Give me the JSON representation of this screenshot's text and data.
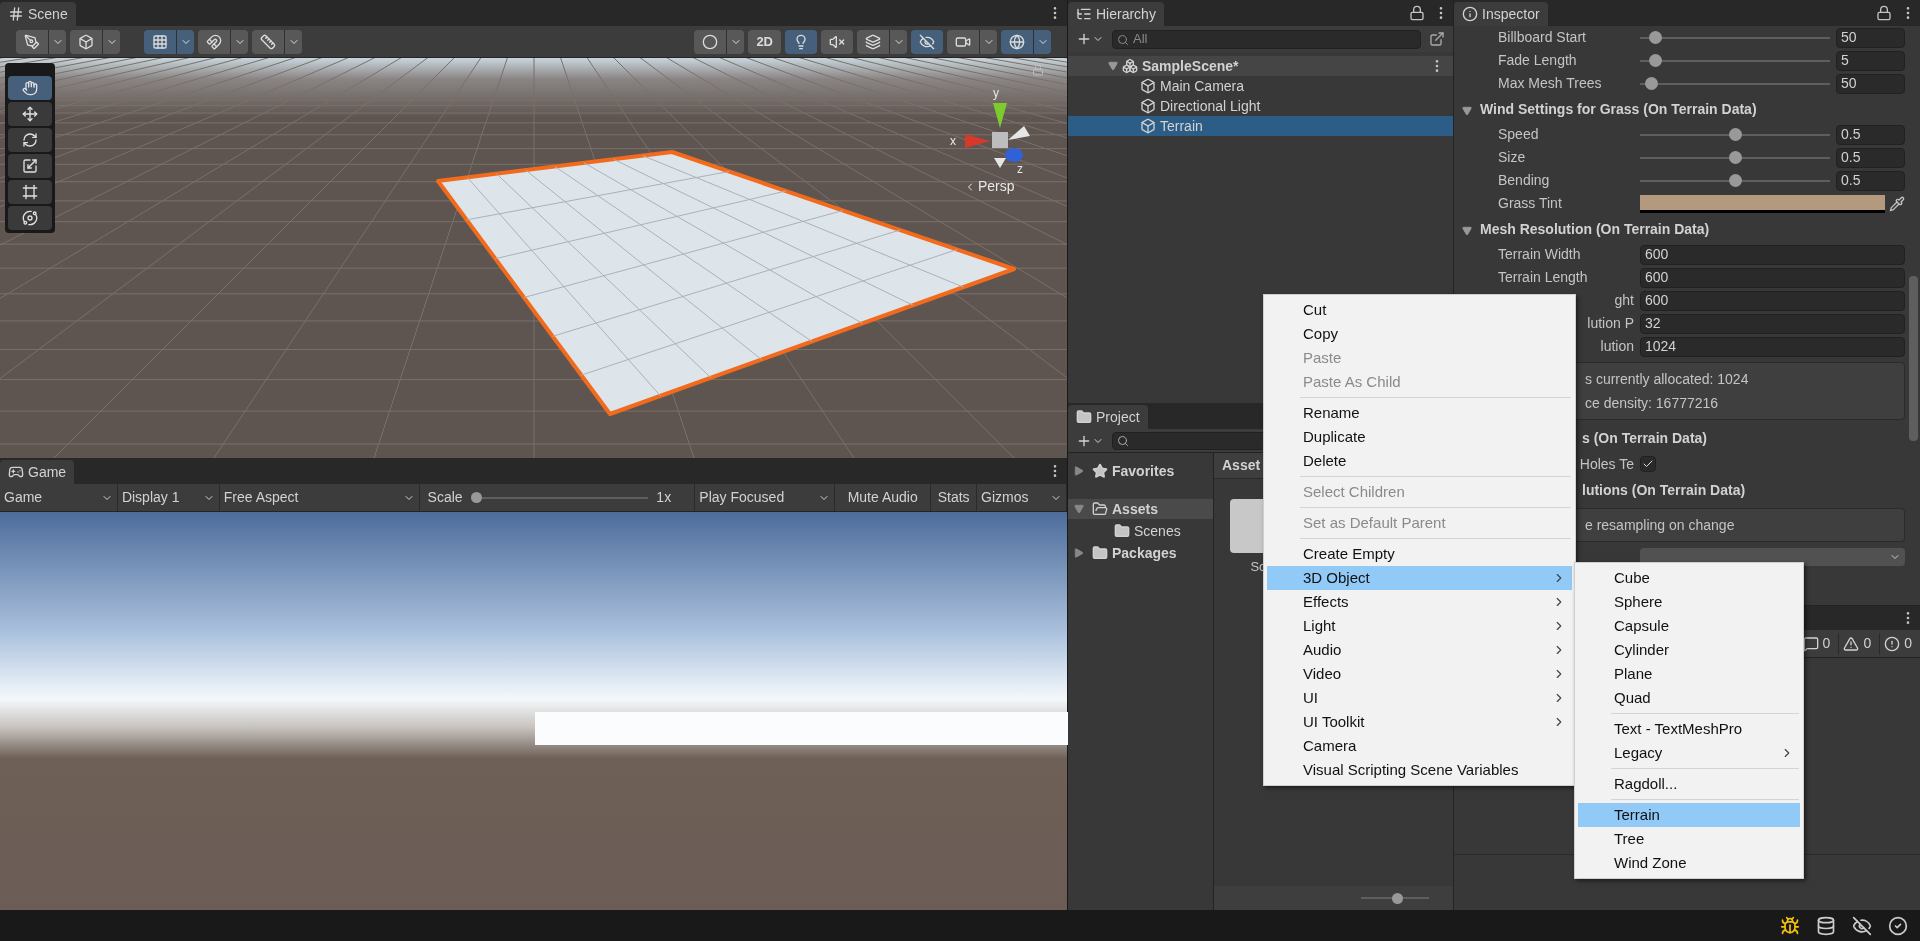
{
  "scene": {
    "tab": "Scene",
    "toolbar_left": [
      {
        "kind": "tool-handle",
        "on": false,
        "dropdown": true
      },
      {
        "kind": "pivot",
        "on": false,
        "dropdown": true
      }
    ],
    "toolbar_grid": [
      {
        "kind": "grid",
        "on": true,
        "dropdown": true
      },
      {
        "kind": "snap",
        "on": false,
        "dropdown": true
      },
      {
        "kind": "increment",
        "on": false,
        "dropdown": true
      }
    ],
    "toolbar_right": [
      {
        "kind": "shading",
        "on": false,
        "dropdown": true
      },
      {
        "kind": "label",
        "label": "2D",
        "on": false,
        "dropdown": false
      },
      {
        "kind": "lighting",
        "on": true,
        "dropdown": false
      },
      {
        "kind": "audio",
        "on": false,
        "dropdown": false
      },
      {
        "kind": "effects",
        "on": false,
        "dropdown": true
      },
      {
        "kind": "visibility",
        "on": true,
        "dropdown": false
      },
      {
        "kind": "camera",
        "on": false,
        "dropdown": true
      },
      {
        "kind": "gizmos",
        "on": true,
        "dropdown": true
      }
    ],
    "tools": [
      {
        "kind": "hand",
        "selected": true
      },
      {
        "kind": "move",
        "selected": false
      },
      {
        "kind": "rotate",
        "selected": false
      },
      {
        "kind": "scale",
        "selected": false
      },
      {
        "kind": "rect",
        "selected": false
      },
      {
        "kind": "transform",
        "selected": false
      }
    ],
    "axis_labels": [
      "x",
      "y",
      "z"
    ],
    "view_label": "Persp"
  },
  "game": {
    "tab": "Game",
    "toolbar": [
      {
        "kind": "dropdown",
        "label": "Game"
      },
      {
        "kind": "dropdown",
        "label": "Display 1"
      },
      {
        "kind": "dropdown",
        "label": "Free Aspect"
      },
      {
        "kind": "slider",
        "label": "Scale",
        "level": 0.0,
        "reading": "1x"
      },
      {
        "kind": "dropdown",
        "label": "Play Focused"
      },
      {
        "kind": "toggle",
        "label": "Mute Audio",
        "on": false
      },
      {
        "kind": "toggle",
        "label": "Stats",
        "on": false
      },
      {
        "kind": "dropdown",
        "label": "Gizmos"
      }
    ]
  },
  "hierarchy": {
    "tab": "Hierarchy",
    "search": {
      "placeholder": "All"
    },
    "tree": [
      {
        "label": "SampleScene*",
        "kind": "scene",
        "expanded": true,
        "selected": false,
        "children": [
          {
            "label": "Main Camera",
            "kind": "object",
            "selected": false
          },
          {
            "label": "Directional Light",
            "kind": "object",
            "selected": false
          },
          {
            "label": "Terrain",
            "kind": "object",
            "selected": true
          }
        ]
      }
    ]
  },
  "project": {
    "tab": "Project",
    "tree": [
      {
        "label": "Favorites",
        "kind": "favorites",
        "expanded": false,
        "selected": false
      },
      {
        "label": "Assets",
        "kind": "folder",
        "expanded": true,
        "selected": true,
        "children": [
          {
            "label": "Scenes",
            "kind": "folder",
            "selected": false
          }
        ]
      },
      {
        "label": "Packages",
        "kind": "folder",
        "expanded": false,
        "selected": false
      }
    ],
    "breadcrumb": "Asset",
    "assets": [
      {
        "label": "Sc"
      }
    ],
    "zoom": {
      "level": 0.55
    }
  },
  "inspector": {
    "tab": "Inspector",
    "rows": [
      {
        "kind": "slider",
        "label": "Billboard Start",
        "level": 0.05,
        "value": "50"
      },
      {
        "kind": "slider",
        "label": "Fade Length",
        "level": 0.05,
        "value": "5"
      },
      {
        "kind": "slider",
        "label": "Max Mesh Trees",
        "level": 0.03,
        "value": "50"
      },
      {
        "kind": "header",
        "label": "Wind Settings for Grass (On Terrain Data)",
        "expanded": true
      },
      {
        "kind": "slider",
        "label": "Speed",
        "level": 0.5,
        "value": "0.5"
      },
      {
        "kind": "slider",
        "label": "Size",
        "level": 0.5,
        "value": "0.5"
      },
      {
        "kind": "slider",
        "label": "Bending",
        "level": 0.5,
        "value": "0.5"
      },
      {
        "kind": "color",
        "label": "Grass Tint",
        "color": "#b39a7f"
      },
      {
        "kind": "header",
        "label": "Mesh Resolution (On Terrain Data)",
        "expanded": true
      },
      {
        "kind": "field",
        "label": "Terrain Width",
        "value": "600"
      },
      {
        "kind": "field",
        "label": "Terrain Length",
        "value": "600"
      },
      {
        "kind": "field",
        "label": "ght",
        "value": "600",
        "covered": true
      },
      {
        "kind": "field",
        "label": "lution P",
        "value": "32",
        "covered": true
      },
      {
        "kind": "field",
        "label": "lution",
        "value": "1024",
        "covered": true
      },
      {
        "kind": "help",
        "lines": [
          "s currently allocated: 1024",
          "ce density: 16777216"
        ],
        "covered": true
      },
      {
        "kind": "header",
        "label": "s (On Terrain Data)",
        "covered": true
      },
      {
        "kind": "checkbox",
        "label": "Holes Te",
        "checked": true,
        "covered": true
      },
      {
        "kind": "header",
        "label": "lutions (On Terrain Data)",
        "covered": true
      },
      {
        "kind": "help",
        "lines": [
          "e resampling on change"
        ],
        "covered": true
      },
      {
        "kind": "dropdown"
      }
    ]
  },
  "console": {
    "counts": [
      {
        "kind": "log",
        "count": "0"
      },
      {
        "kind": "warning",
        "count": "0"
      },
      {
        "kind": "error",
        "count": "0"
      }
    ]
  },
  "menu": {
    "groups": [
      {
        "items": [
          {
            "label": "Cut",
            "disabled": false
          },
          {
            "label": "Copy",
            "disabled": false
          },
          {
            "label": "Paste",
            "disabled": true
          },
          {
            "label": "Paste As Child",
            "disabled": true
          }
        ]
      },
      {
        "items": [
          {
            "label": "Rename",
            "disabled": false
          },
          {
            "label": "Duplicate",
            "disabled": false
          },
          {
            "label": "Delete",
            "disabled": false
          }
        ]
      },
      {
        "items": [
          {
            "label": "Select Children",
            "disabled": true
          }
        ]
      },
      {
        "items": [
          {
            "label": "Set as Default Parent",
            "disabled": true
          }
        ]
      },
      {
        "items": [
          {
            "label": "Create Empty",
            "disabled": false,
            "selected": false
          },
          {
            "label": "3D Object",
            "disabled": false,
            "selected": true,
            "has_submenu": true,
            "submenu": {
              "groups": [
                {
                  "items": [
                    {
                      "label": "Cube",
                      "selected": false
                    },
                    {
                      "label": "Sphere",
                      "selected": false
                    },
                    {
                      "label": "Capsule",
                      "selected": false
                    },
                    {
                      "label": "Cylinder",
                      "selected": false
                    },
                    {
                      "label": "Plane",
                      "selected": false
                    },
                    {
                      "label": "Quad",
                      "selected": false
                    }
                  ]
                },
                {
                  "items": [
                    {
                      "label": "Text - TextMeshPro",
                      "selected": false
                    },
                    {
                      "label": "Legacy",
                      "selected": false,
                      "has_submenu": true
                    }
                  ]
                },
                {
                  "items": [
                    {
                      "label": "Ragdoll...",
                      "selected": false
                    }
                  ]
                },
                {
                  "items": [
                    {
                      "label": "Terrain",
                      "selected": true
                    },
                    {
                      "label": "Tree",
                      "selected": false
                    },
                    {
                      "label": "Wind Zone",
                      "selected": false
                    }
                  ]
                }
              ]
            }
          },
          {
            "label": "Effects",
            "disabled": false,
            "selected": false,
            "has_submenu": true
          },
          {
            "label": "Light",
            "disabled": false,
            "selected": false,
            "has_submenu": true
          },
          {
            "label": "Audio",
            "disabled": false,
            "selected": false,
            "has_submenu": true
          },
          {
            "label": "Video",
            "disabled": false,
            "selected": false,
            "has_submenu": true
          },
          {
            "label": "UI",
            "disabled": false,
            "selected": false,
            "has_submenu": true
          },
          {
            "label": "UI Toolkit",
            "disabled": false,
            "selected": false,
            "has_submenu": true
          },
          {
            "label": "Camera",
            "disabled": false,
            "selected": false
          },
          {
            "label": "Visual Scripting Scene Variables",
            "disabled": false,
            "selected": false
          }
        ]
      }
    ]
  }
}
